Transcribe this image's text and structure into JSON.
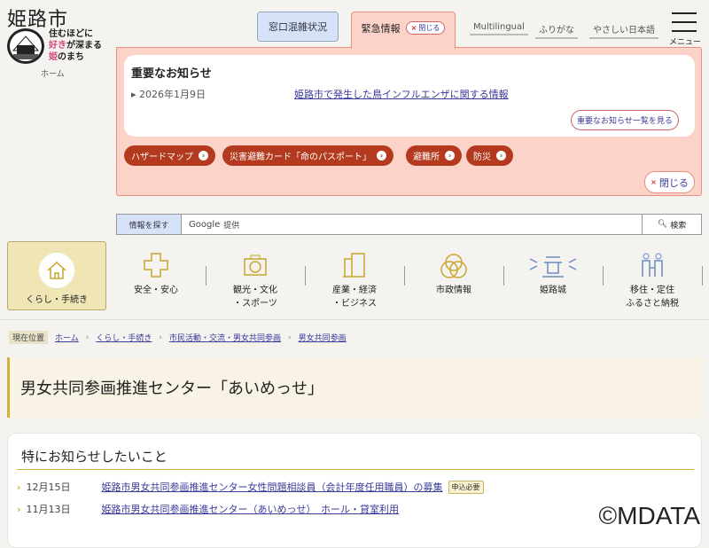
{
  "header": {
    "site_title": "姫路市",
    "slogan": [
      "住むほどに",
      "好き",
      "が深まる",
      "姫",
      "のまち"
    ],
    "home": "ホーム",
    "tab_crowd": "窓口混雑状況",
    "tab_emergency": "緊急情報",
    "tab_close": "閉じる",
    "links": [
      "Multilingual",
      "ふりがな",
      "やさしい日本語"
    ],
    "menu": "メニュー"
  },
  "emergency": {
    "title": "重要なお知らせ",
    "date": "2026年1月9日",
    "link": "姫路市で発生した鳥インフルエンザに関する情報",
    "all": "重要なお知らせ一覧を見る",
    "pills": [
      "ハザードマップ",
      "災害避難カード「命のパスポート」",
      "避難所",
      "防災"
    ],
    "close": "閉じる"
  },
  "search": {
    "label": "情報を探す",
    "google": "Google",
    "provided": "提供",
    "button": "検索"
  },
  "nav": [
    {
      "l1": "くらし・手続き",
      "l2": ""
    },
    {
      "l1": "安全・安心",
      "l2": ""
    },
    {
      "l1": "観光・文化",
      "l2": "・スポーツ"
    },
    {
      "l1": "産業・経済",
      "l2": "・ビジネス"
    },
    {
      "l1": "市政情報",
      "l2": ""
    },
    {
      "l1": "姫路城",
      "l2": ""
    },
    {
      "l1": "移住・定住",
      "l2": "ふるさと納税"
    }
  ],
  "breadcrumb": {
    "current_label": "現在位置",
    "items": [
      "ホーム",
      "くらし・手続き",
      "市民活動・交流・男女共同参画",
      "男女共同参画"
    ]
  },
  "page_title": "男女共同参画推進センター「あいめっせ」",
  "notices": {
    "heading": "特にお知らせしたいこと",
    "items": [
      {
        "date": "12月15日",
        "text": "姫路市男女共同参画推進センター女性問題相談員（会計年度任用職員）の募集",
        "tag": "申込必要"
      },
      {
        "date": "11月13日",
        "text": "姫路市男女共同参画推進センター（あいめっせ）　ホール・貸室利用"
      }
    ]
  },
  "watermark": "©MDATA",
  "colors": {
    "emergency_bg": "#fcd3c8",
    "pill": "#b33a1e",
    "accent_gold": "#d4b03a",
    "link": "#3a3a9a"
  }
}
